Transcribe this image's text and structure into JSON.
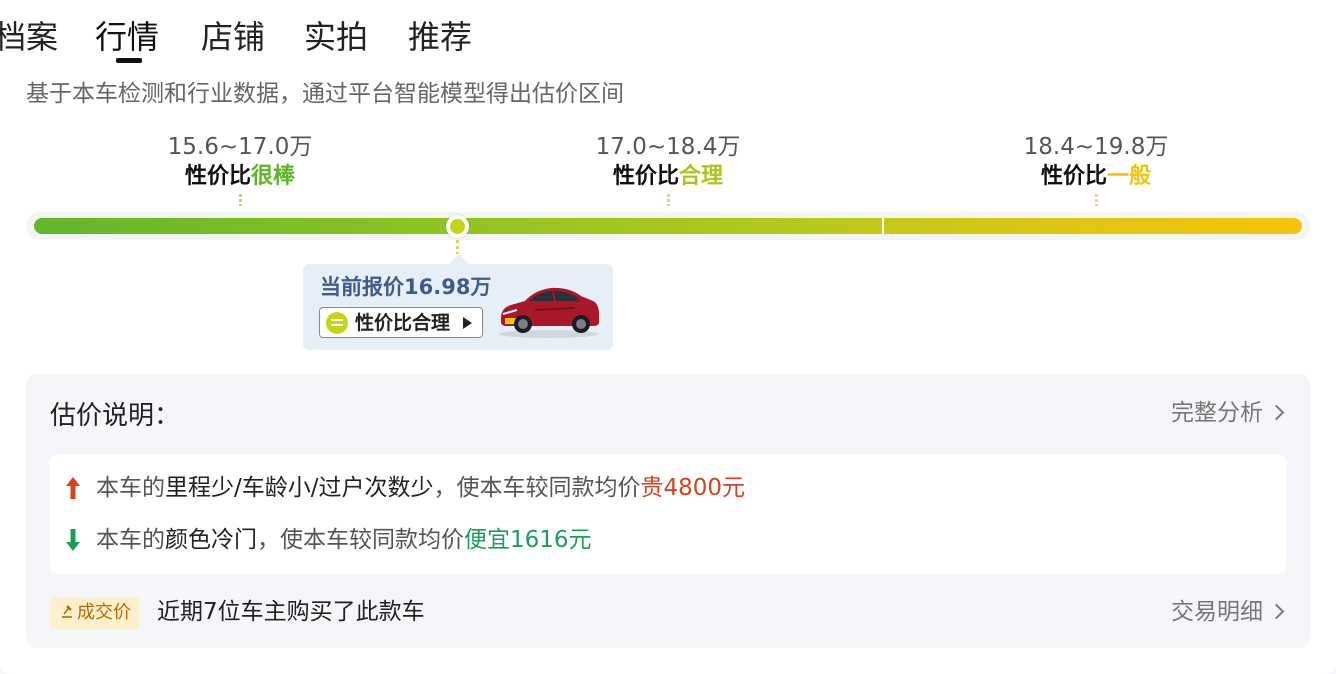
{
  "tabs": [
    {
      "label": "档案"
    },
    {
      "label": "行情",
      "active": true
    },
    {
      "label": "店铺"
    },
    {
      "label": "实拍"
    },
    {
      "label": "推荐"
    }
  ],
  "subtitle": "基于本车检测和行业数据，通过平台智能模型得出估价区间",
  "ranges": [
    {
      "price": "15.6~17.0万",
      "prefix": "性价比",
      "rating": "很棒",
      "color": "#5fb42a"
    },
    {
      "price": "17.0~18.4万",
      "prefix": "性价比",
      "rating": "合理",
      "color": "#a8c81c"
    },
    {
      "price": "18.4~19.8万",
      "prefix": "性价比",
      "rating": "一般",
      "color": "#f2c30f"
    }
  ],
  "marker_fraction": 0.33,
  "current_quote": {
    "text": "当前报价16.98万",
    "rating_label": "性价比合理",
    "icon": "balance-icon",
    "image": "red-suv"
  },
  "explanation": {
    "title": "估价说明：",
    "link": "完整分析",
    "items": [
      {
        "direction": "up",
        "icon": "arrow-up-icon",
        "prefix": "本车的",
        "factor": "里程少/车龄小/过户次数少",
        "middle": "，使本车较同款均价",
        "effect": "贵4800元",
        "color": "#d4421f"
      },
      {
        "direction": "down",
        "icon": "arrow-down-icon",
        "prefix": "本车的",
        "factor": "颜色冷门",
        "middle": "，使本车较同款均价",
        "effect": "便宜1616元",
        "color": "#1d9c5a"
      }
    ],
    "deal_tag": "成交价",
    "deal_text": "近期7位车主购买了此款车",
    "deal_link": "交易明细"
  }
}
